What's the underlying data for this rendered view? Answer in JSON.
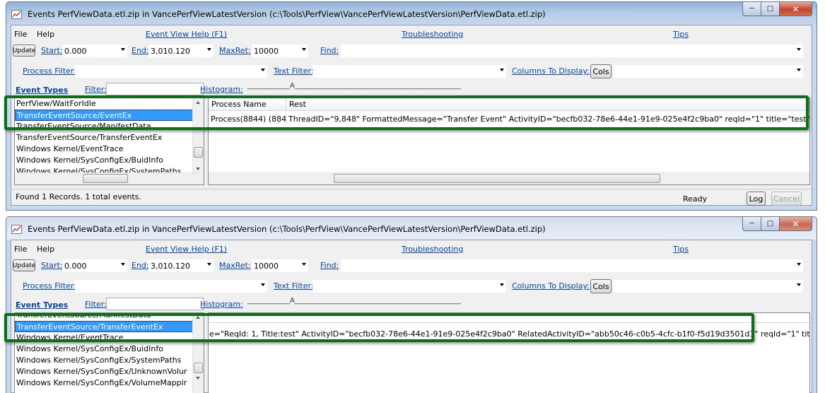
{
  "windows": [
    {
      "title": "Events PerfViewData.etl.zip in VancePerfViewLatestVersion (c:\\Tools\\PerfView\\VancePerfViewLatestVersion\\PerfViewData.etl.zip)",
      "menu": {
        "file": "File",
        "help": "Help",
        "event_view_help": "Event View Help (F1)",
        "troubleshooting": "Troubleshooting",
        "tips": "Tips"
      },
      "toolbar": {
        "update": "Update",
        "start_label": "Start:",
        "start_value": "0.000",
        "end_label": "End:",
        "end_value": "3,010.120",
        "maxret_label": "MaxRet:",
        "maxret_value": "10000",
        "find_label": "Find:"
      },
      "filters": {
        "process_filter": "Process Filter:",
        "text_filter": "Text Filter:",
        "columns_to_display": "Columns To Display:",
        "cols_button": "Cols"
      },
      "event_types": {
        "label": "Event Types",
        "filter_label": "Filter:",
        "histogram_label": "Histogram:",
        "histogram_value": "____________A_______________________________________________"
      },
      "event_list": [
        "PerfView/WaitForIdle",
        "TransferEventSource/EventEx",
        "TransferEventSource/ManifestData",
        "TransferEventSource/TransferEventEx",
        "Windows Kernel/EventTrace",
        "Windows Kernel/SysConfigEx/BuidInfo",
        "Windows Kernel/SysConfigEx/SystemPaths"
      ],
      "selected_index": 1,
      "grid": {
        "columns": [
          "Process Name",
          "Rest"
        ],
        "row": {
          "process": "Process(8844) (8844)",
          "rest": "ThreadID=\"9,848\" FormattedMessage=\"Transfer Event\" ActivityID=\"becfb032-78e6-44e1-91e9-025e4f2c9ba0\" reqId=\"1\" title=\"test\""
        }
      },
      "status": {
        "text": "Found 1 Records.  1 total events.",
        "ready": "Ready",
        "log": "Log",
        "cancel": "Cancel"
      }
    },
    {
      "title": "Events PerfViewData.etl.zip in VancePerfViewLatestVersion (c:\\Tools\\PerfView\\VancePerfViewLatestVersion\\PerfViewData.etl.zip)",
      "menu": {
        "file": "File",
        "help": "Help",
        "event_view_help": "Event View Help (F1)",
        "troubleshooting": "Troubleshooting",
        "tips": "Tips"
      },
      "toolbar": {
        "update": "Update",
        "start_label": "Start:",
        "start_value": "0.000",
        "end_label": "End:",
        "end_value": "3,010.120",
        "maxret_label": "MaxRet:",
        "maxret_value": "10000",
        "find_label": "Find:"
      },
      "filters": {
        "process_filter": "Process Filter:",
        "text_filter": "Text Filter:",
        "columns_to_display": "Columns To Display:",
        "cols_button": "Cols"
      },
      "event_types": {
        "label": "Event Types",
        "filter_label": "Filter:",
        "histogram_label": "Histogram:",
        "histogram_value": "____________A_______________________________________________"
      },
      "event_list": [
        "TransferEventSource/ManifestData",
        "TransferEventSource/TransferEventEx",
        "Windows Kernel/EventTrace",
        "Windows Kernel/SysConfigEx/BuidInfo",
        "Windows Kernel/SysConfigEx/SystemPaths",
        "Windows Kernel/SysConfigEx/UnknownVolur",
        "Windows Kernel/SysConfigEx/VolumeMappir"
      ],
      "selected_index": 1,
      "grid": {
        "row": {
          "rest": "e=\"ReqId: 1, Title:test\" ActivityID=\"becfb032-78e6-44e1-91e9-025e4f2c9ba0\" RelatedActivityID=\"abb50c46-c0b5-4cfc-b1f0-f5d19d3501d1\" reqId=\"1\" title=\"test\""
        }
      }
    }
  ],
  "colors": {
    "highlight_box": "#0b6e18",
    "selection": "#3399ff",
    "link": "#0645ad"
  }
}
